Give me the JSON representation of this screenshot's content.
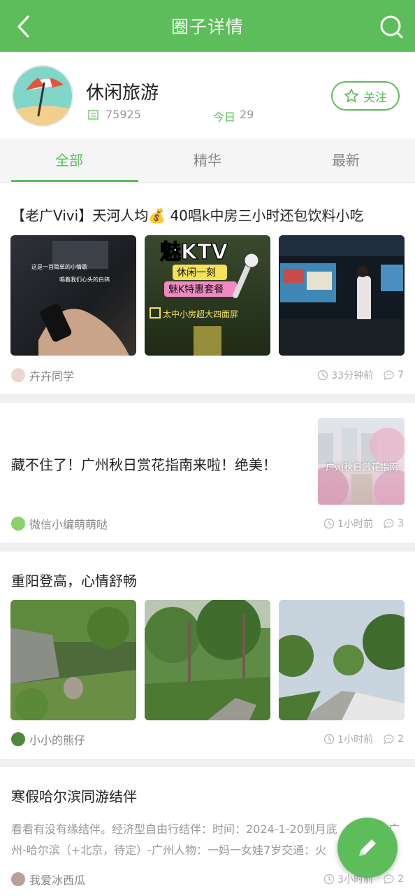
{
  "header": {
    "title": "圈子详情",
    "back_icon": "back-arrow-icon",
    "search_icon": "search-icon"
  },
  "group": {
    "name": "休闲旅游",
    "member_count": "75925",
    "today_label": "今日",
    "today_count": "29",
    "follow_label": "关注"
  },
  "tabs": [
    {
      "label": "全部",
      "active": true
    },
    {
      "label": "精华",
      "active": false
    },
    {
      "label": "最新",
      "active": false
    }
  ],
  "posts": [
    {
      "title": "【老广Vivi】天河人均💰 40唱k中房三小时还包饮料小吃",
      "images": [
        {
          "caption_line1": "这是一首简单的小情歌",
          "caption_line2": "唱着我们心头的白鸽"
        },
        {
          "line1": "魅KTV",
          "line2": "休闲一刻",
          "line3": "魅K特惠套餐",
          "line4": "太中小房超大四面屏"
        },
        {
          "caption": ""
        }
      ],
      "author": "卉卉同学",
      "time": "33分钟前",
      "comments": "7"
    },
    {
      "title": "藏不住了！广州秋日赏花指南来啦！绝美！",
      "thumb_text": "广州秋日赏花指南",
      "author": "微信小编萌萌哒",
      "time": "1小时前",
      "comments": "3"
    },
    {
      "title": "重阳登高，心情舒畅",
      "author": "小小的熊仔",
      "time": "1小时前",
      "comments": "2"
    },
    {
      "title": "寒假哈尔滨同游结伴",
      "body_line1": "看看有没有缘结伴。经济型自由行结伴：时间：2024-1-20到月底",
      "body_line1b": "广",
      "body_line2": "州-哈尔滨（+北京，待定）-广州人物：一妈一女娃7岁交通：火",
      "author": "我爱冰西瓜",
      "time": "3小时前",
      "comments": "2"
    }
  ],
  "fab_icon": "pencil-icon",
  "colors": {
    "brand_green": "#5cbd5a"
  }
}
